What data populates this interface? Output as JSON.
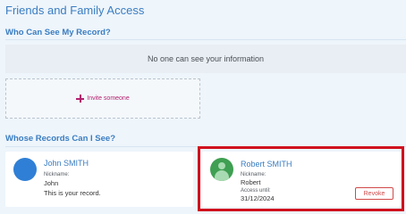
{
  "page": {
    "title": "Friends and Family Access"
  },
  "who_can_see": {
    "heading": "Who Can See My Record?",
    "empty_message": "No one can see your information",
    "invite_label": "Invite someone"
  },
  "whose_records": {
    "heading": "Whose Records Can I See?",
    "cards": [
      {
        "name": "John SMITH",
        "nickname_label": "Nickname:",
        "nickname": "John",
        "note": "This is your record.",
        "avatar_color": "#2f7fd6"
      },
      {
        "name": "Robert SMITH",
        "nickname_label": "Nickname:",
        "nickname": "Robert",
        "access_label": "Access until:",
        "access_until": "31/12/2024",
        "revoke_label": "Revoke",
        "avatar_color": "#3f9f52",
        "highlight_color": "#d0101d"
      }
    ]
  },
  "colors": {
    "accent": "#3a7dc2",
    "invite": "#b41f6e",
    "revoke": "#d04a4a"
  }
}
